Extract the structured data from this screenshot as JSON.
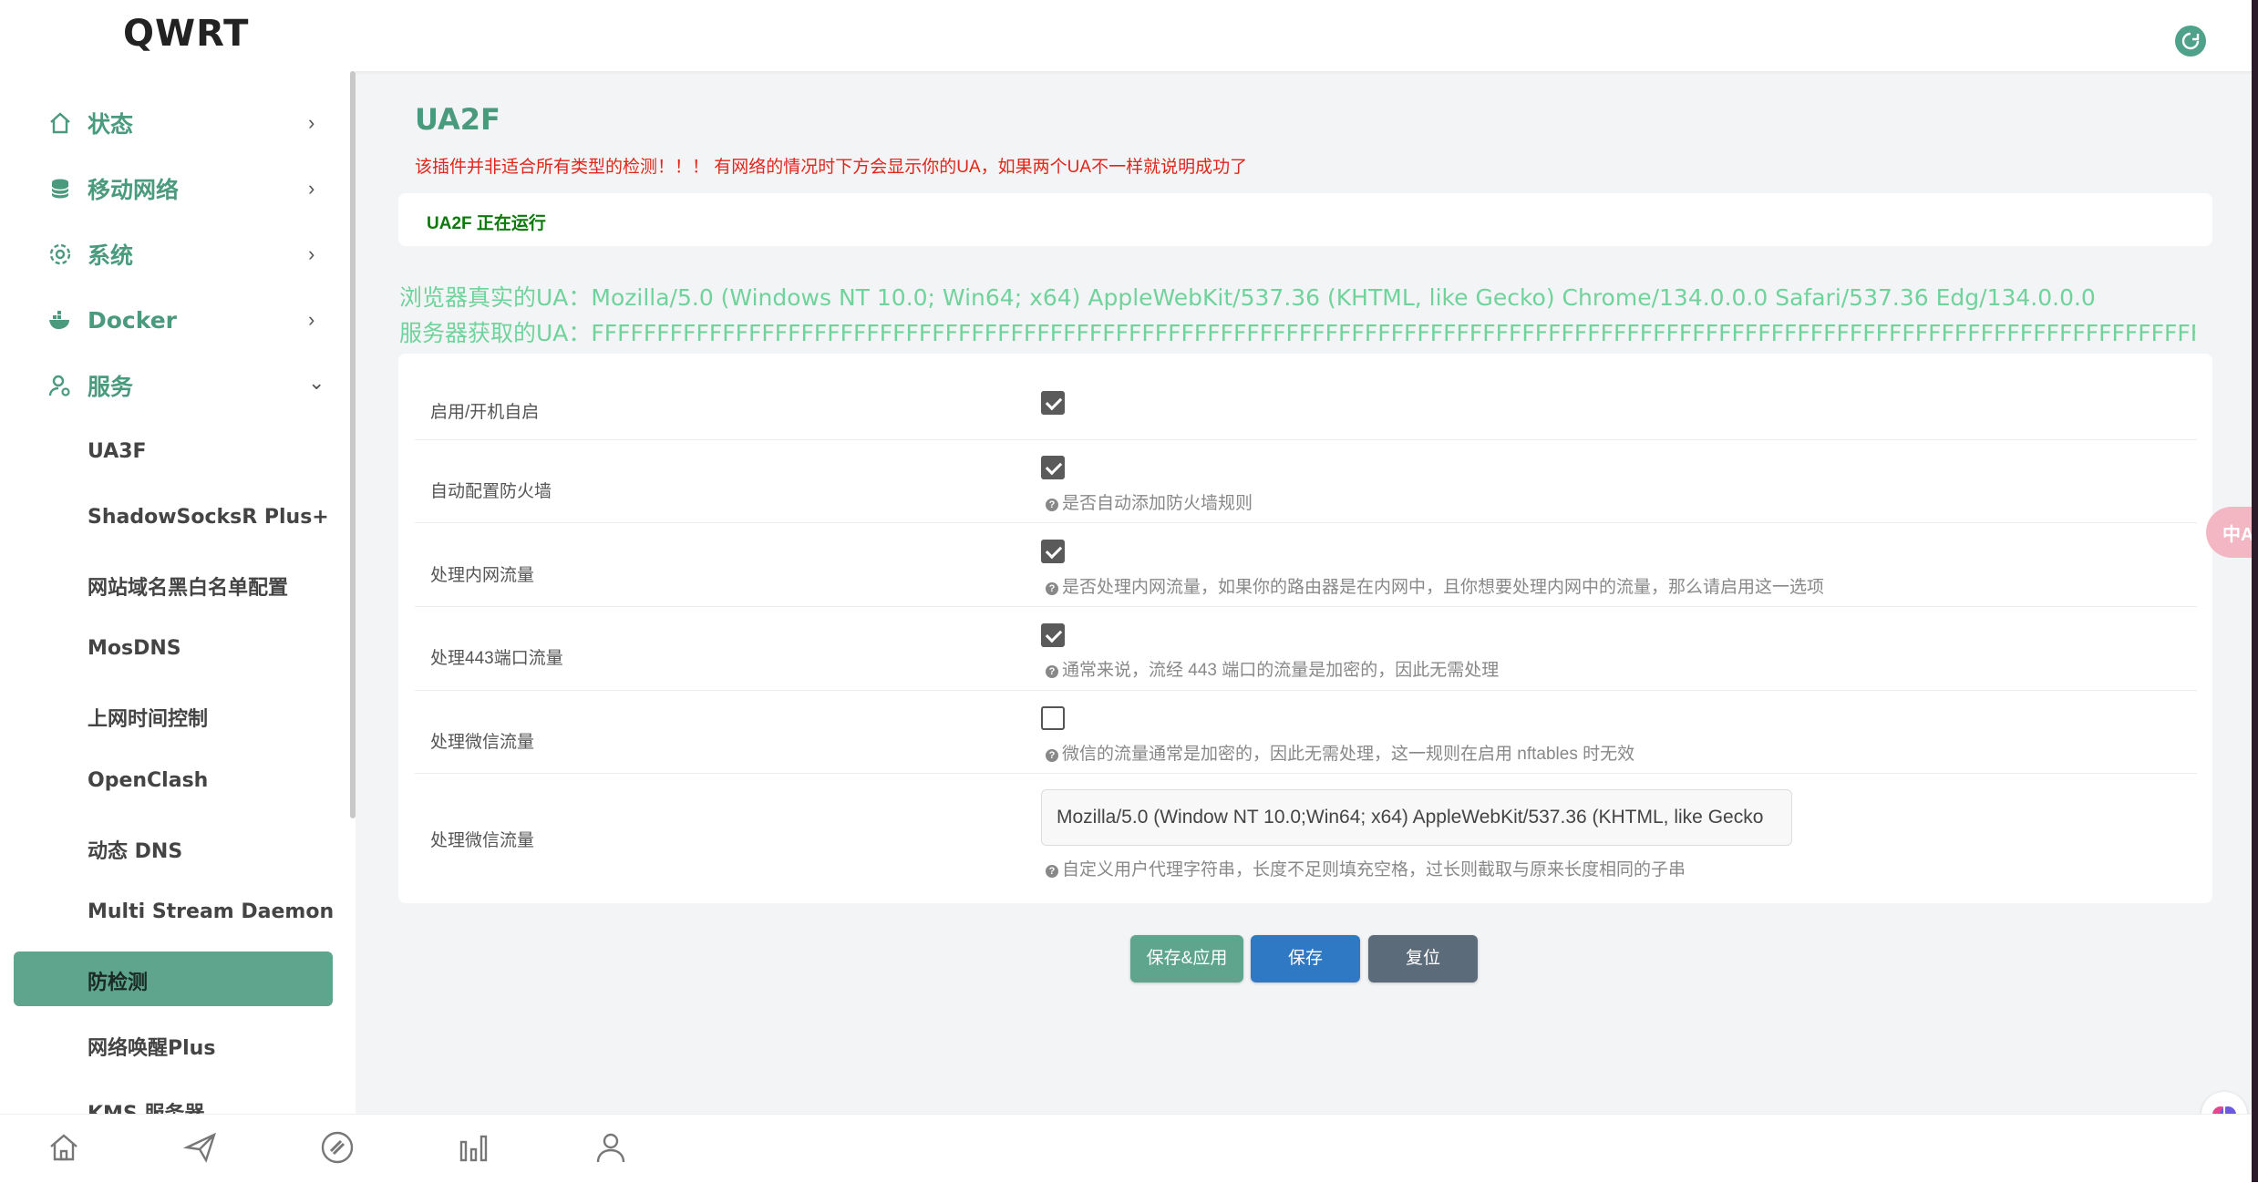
{
  "brand": "QWRT",
  "sidebar": {
    "groups": [
      {
        "label": "状态",
        "icon": "home-icon",
        "chevron": "›"
      },
      {
        "label": "移动网络",
        "icon": "database-icon",
        "chevron": "›"
      },
      {
        "label": "系统",
        "icon": "gear-icon",
        "chevron": "›"
      },
      {
        "label": "Docker",
        "icon": "docker-icon",
        "chevron": "›"
      },
      {
        "label": "服务",
        "icon": "user-gear-icon",
        "chevron": "⌄"
      }
    ],
    "sub_items": [
      "UA3F",
      "ShadowSocksR Plus+",
      "网站域名黑白名单配置",
      "MosDNS",
      "上网时间控制",
      "OpenClash",
      "动态 DNS",
      "Multi Stream Daemon",
      "防检测",
      "网络唤醒Plus",
      "KMS 服务器"
    ],
    "active_sub": "防检测"
  },
  "main": {
    "title": "UA2F",
    "warning": "该插件并非适合所有类型的检测！！！ 有网络的情况时下方会显示你的UA，如果两个UA不一样就说明成功了",
    "status": "UA2F 正在运行",
    "browser_ua": "浏览器真实的UA：Mozilla/5.0 (Windows NT 10.0; Win64; x64) AppleWebKit/537.36 (KHTML, like Gecko) Chrome/134.0.0.0 Safari/537.36 Edg/134.0.0.0",
    "server_ua": "服务器获取的UA：FFFFFFFFFFFFFFFFFFFFFFFFFFFFFFFFFFFFFFFFFFFFFFFFFFFFFFFFFFFFFFFFFFFFFFFFFFFFFFFFFFFFFFFFFFFFFFFFFFFFFFFFFFFFFFFFFFFFFFFFFFFFFFFFFFF",
    "form": {
      "rows": [
        {
          "label": "启用/开机自启",
          "checked": true,
          "hint": ""
        },
        {
          "label": "自动配置防火墙",
          "checked": true,
          "hint": "是否自动添加防火墙规则"
        },
        {
          "label": "处理内网流量",
          "checked": true,
          "hint": "是否处理内网流量，如果你的路由器是在内网中，且你想要处理内网中的流量，那么请启用这一选项"
        },
        {
          "label": "处理443端口流量",
          "checked": true,
          "hint": "通常来说，流经 443 端口的流量是加密的，因此无需处理"
        },
        {
          "label": "处理微信流量",
          "checked": false,
          "hint": "微信的流量通常是加密的，因此无需处理，这一规则在启用 nftables 时无效"
        }
      ],
      "ua_row": {
        "label": "处理微信流量",
        "value": "Mozilla/5.0 (Window NT 10.0;Win64; x64) AppleWebKit/537.36 (KHTML, like Gecko",
        "hint": "自定义用户代理字符串，长度不足则填充空格，过长则截取与原来长度相同的子串"
      }
    },
    "buttons": {
      "save_apply": "保存&应用",
      "save": "保存",
      "reset": "复位"
    }
  },
  "colors": {
    "accent": "#4a9a7e",
    "warning": "#e0251b",
    "ua_text": "#6fd39b",
    "save_apply_bg": "#5fa58d",
    "save_bg": "#2f78c4",
    "reset_bg": "#5c6b7a"
  },
  "bottom_nav": [
    "home-icon",
    "send-icon",
    "link-icon",
    "bar-chart-icon",
    "user-icon"
  ],
  "float_translate": "中A"
}
